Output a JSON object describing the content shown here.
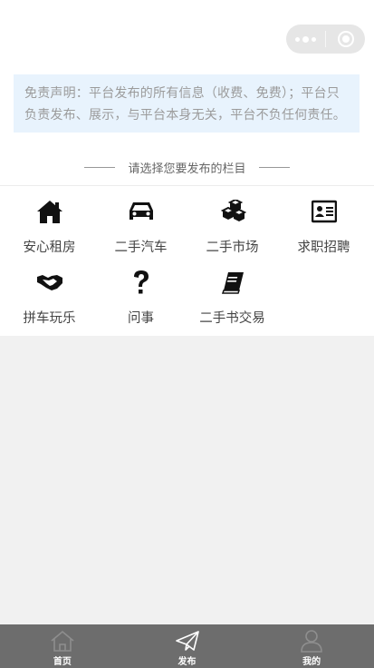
{
  "capsule": {
    "more_icon": "more-dots-icon",
    "close_icon": "target-close-icon"
  },
  "disclaimer": {
    "line1": "免责声明：平台发布的所有信息（收费、免费）；平台只",
    "line2": "负责发布、展示，与平台本身无关，平台不负任何责任。"
  },
  "section": {
    "title": "请选择您要发布的栏目"
  },
  "categories": [
    {
      "label": "安心租房",
      "icon": "house-icon"
    },
    {
      "label": "二手汽车",
      "icon": "car-icon"
    },
    {
      "label": "二手市场",
      "icon": "boxes-icon"
    },
    {
      "label": "求职招聘",
      "icon": "id-card-icon"
    },
    {
      "label": "拼车玩乐",
      "icon": "handshake-icon"
    },
    {
      "label": "问事",
      "icon": "question-icon"
    },
    {
      "label": "二手书交易",
      "icon": "book-icon"
    }
  ],
  "tabbar": [
    {
      "label": "首页",
      "icon": "home-icon"
    },
    {
      "label": "发布",
      "icon": "paper-plane-icon"
    },
    {
      "label": "我的",
      "icon": "user-icon"
    }
  ],
  "colors": {
    "page_bg": "#f1f1f1",
    "notice_bg": "#e8f3fd",
    "tabbar_bg": "#6d6d6d"
  }
}
